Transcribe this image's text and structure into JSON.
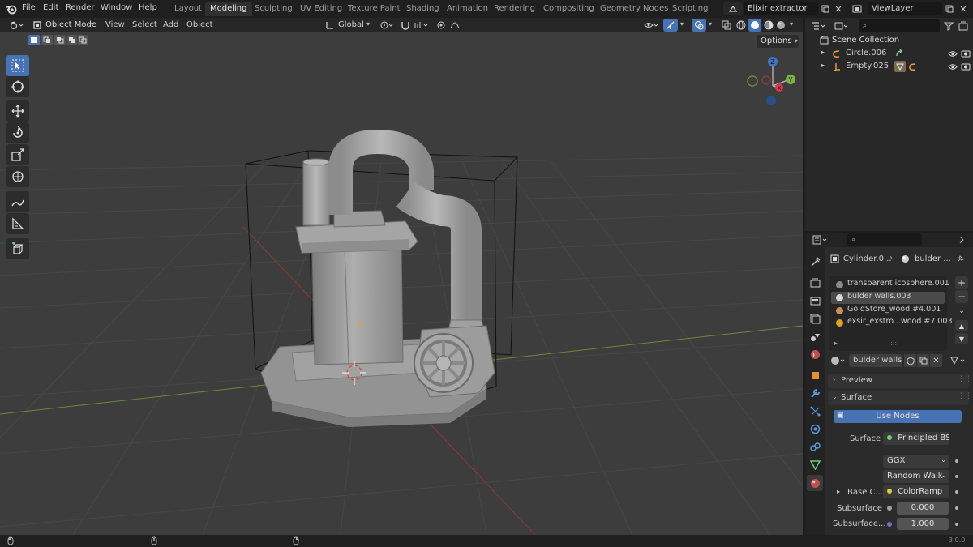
{
  "menu": [
    "File",
    "Edit",
    "Render",
    "Window",
    "Help"
  ],
  "workspaces": [
    {
      "label": "Layout",
      "active": false
    },
    {
      "label": "Modeling",
      "active": true
    },
    {
      "label": "Sculpting",
      "active": false
    },
    {
      "label": "UV Editing",
      "active": false
    },
    {
      "label": "Texture Paint",
      "active": false
    },
    {
      "label": "Shading",
      "active": false
    },
    {
      "label": "Animation",
      "active": false
    },
    {
      "label": "Rendering",
      "active": false
    },
    {
      "label": "Compositing",
      "active": false
    },
    {
      "label": "Geometry Nodes",
      "active": false
    },
    {
      "label": "Scripting",
      "active": false
    }
  ],
  "scene_name": "Elixir extractor",
  "view_layer": "ViewLayer",
  "viewport_header": {
    "mode": "Object Mode",
    "menus": [
      "View",
      "Select",
      "Add",
      "Object"
    ],
    "orientation": "Global",
    "options": "Options"
  },
  "outliner": {
    "root": "Scene Collection",
    "items": [
      {
        "label": "Circle.006",
        "icon": "curve-icon"
      },
      {
        "label": "Empty.025",
        "icon": "empty-icon"
      }
    ]
  },
  "properties": {
    "breadcrumb_object": "Cylinder.0...",
    "breadcrumb_material": "bulder ...",
    "materials": [
      {
        "label": "transparent icosphere.001",
        "color": "#8a8a8a",
        "selected": false
      },
      {
        "label": "bulder walls.003",
        "color": "#d8d8d8",
        "selected": true
      },
      {
        "label": "GoldStore_wood.#4.001",
        "color": "#c89050",
        "selected": false
      },
      {
        "label": "exsir_exstro...wood.#7.003",
        "color": "#e0a020",
        "selected": false
      }
    ],
    "material_name": "bulder walls...",
    "preview": "Preview",
    "surface_panel": "Surface",
    "use_nodes": "Use Nodes",
    "surface_label": "Surface",
    "surface_value": "Principled BS...",
    "distribution": "GGX",
    "subsurface_method": "Random Walk",
    "base_color_label": "Base C...",
    "base_color_value": "ColorRamp",
    "subsurface_label": "Subsurface",
    "subsurface_value": "0.000",
    "subsurface_radius_label": "Subsurface...",
    "subsurface_radius_value": "1.000"
  },
  "status": {
    "version": "3.0.0"
  },
  "colors": {
    "accent": "#4772b3",
    "viewport_bg": "#3d3d3d",
    "model": "#9c9c9c"
  }
}
